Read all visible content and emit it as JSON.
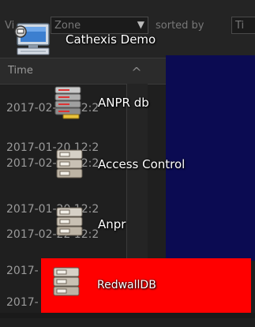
{
  "filter": {
    "prefix": "Vi",
    "zone_value": "Zone",
    "sorted_by_label": "sorted by",
    "sort_value": "Ti"
  },
  "table": {
    "time_header": "Time",
    "rows": [
      "2017-02-22 12:2",
      "2017-01-20 12:2",
      "2017-02-22 12:2",
      "2017-01-20 12:2",
      "2017-02-22 12:2",
      "2017-",
      "2017-"
    ]
  },
  "menu": {
    "items": [
      {
        "label": "Cathexis Demo",
        "icon": "computer-icon"
      },
      {
        "label": "ANPR db",
        "icon": "database-server-icon"
      },
      {
        "label": "Access Control",
        "icon": "server-icon"
      },
      {
        "label": "Anpr",
        "icon": "server-icon"
      },
      {
        "label": "RedwallDB",
        "icon": "server-icon",
        "selected": true
      }
    ]
  },
  "colors": {
    "selected_bg": "#ff0000",
    "video_bg": "#0b0b52",
    "panel_bg": "#1f1f1f"
  }
}
